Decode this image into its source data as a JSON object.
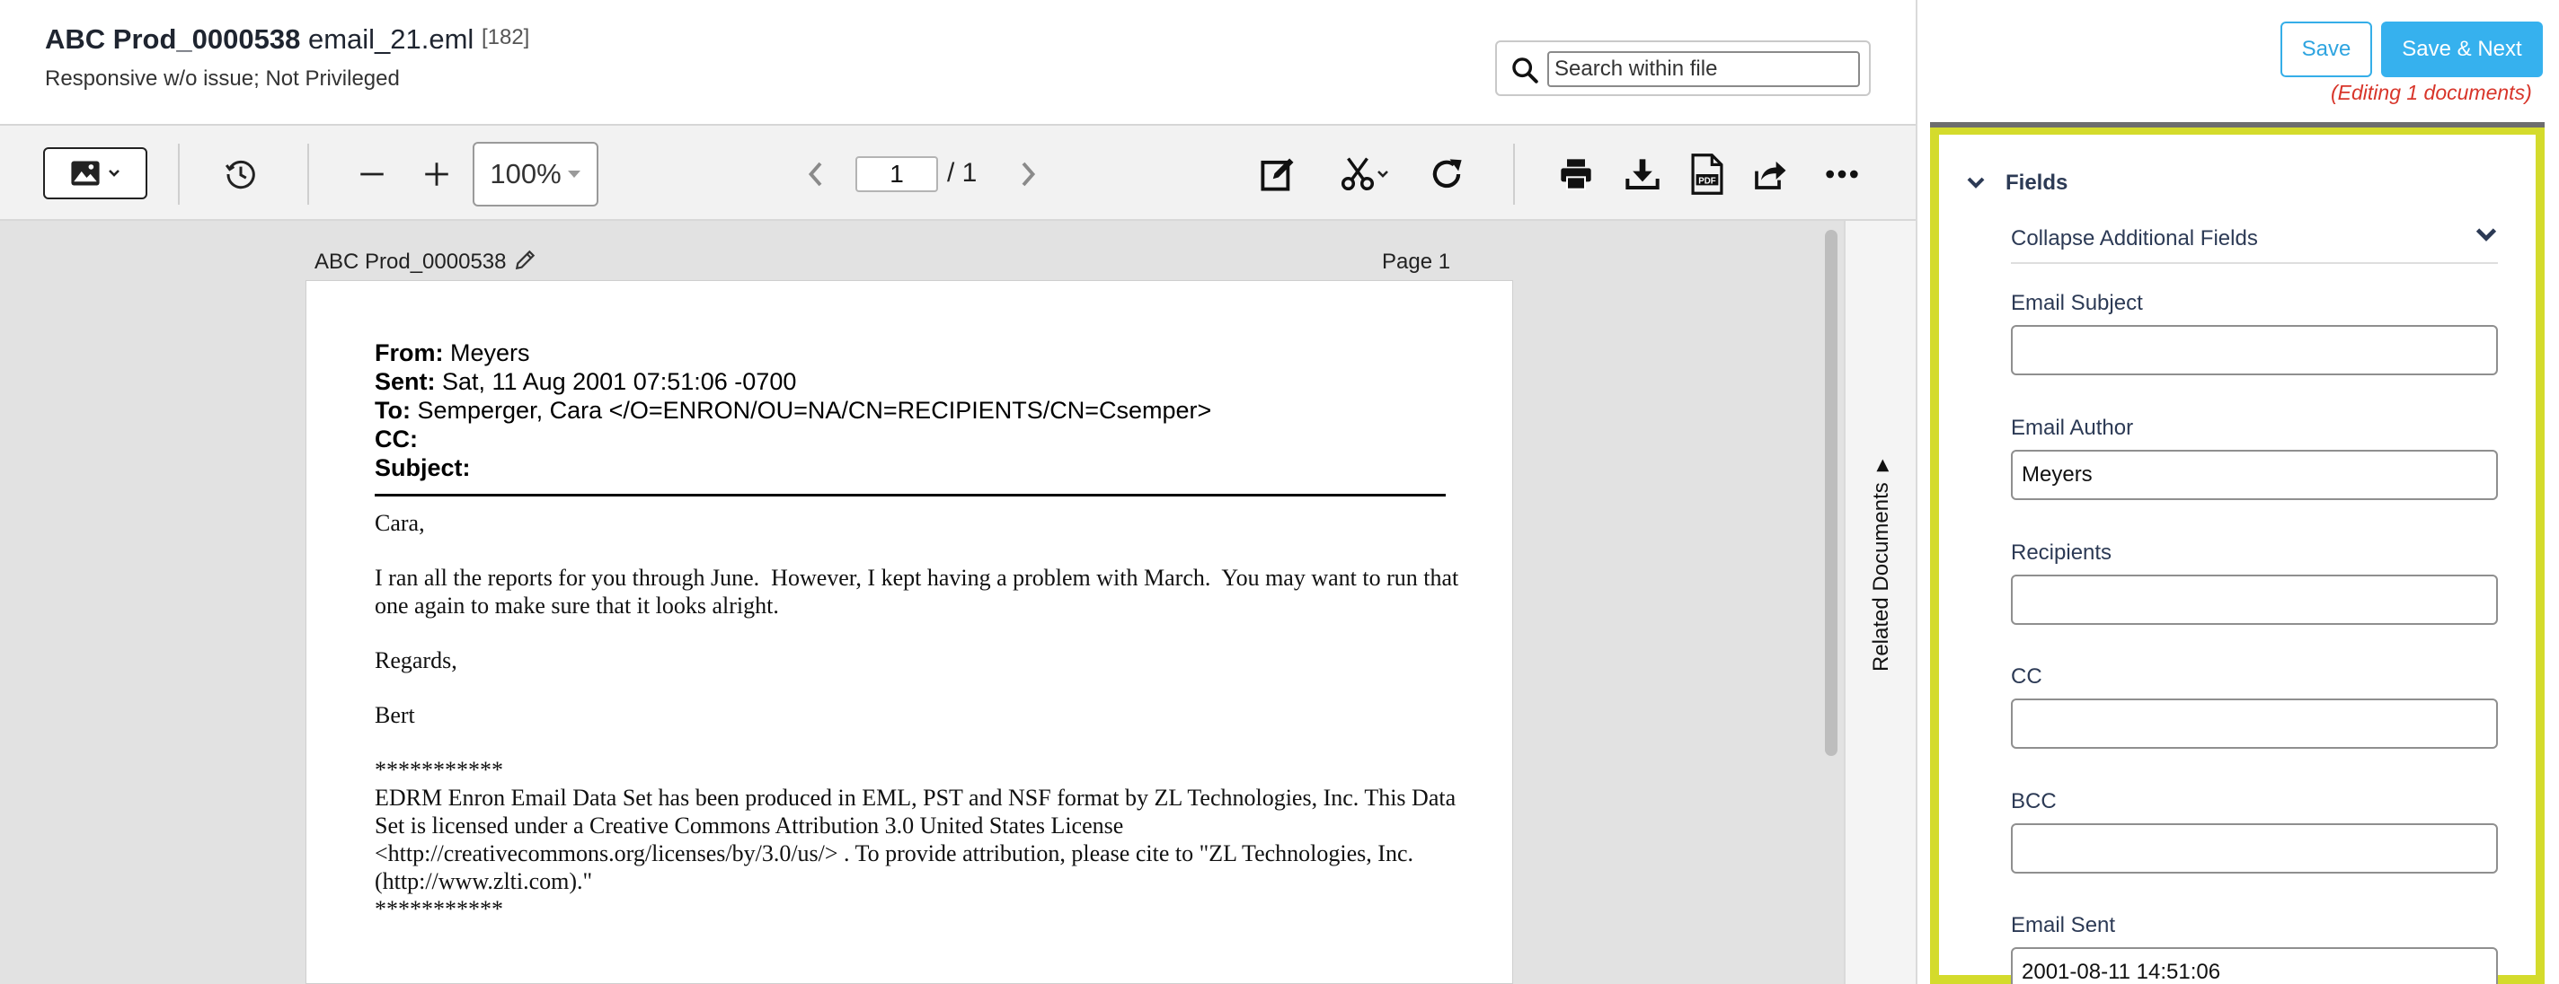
{
  "document": {
    "bates": "ABC Prod_0000538",
    "filename": "email_21.eml",
    "count": "[182]",
    "coding": "Responsive w/o issue; Not Privileged"
  },
  "search": {
    "placeholder": "Search within file"
  },
  "toolbar": {
    "zoom": "100%",
    "page_current": "1",
    "page_total": "/ 1",
    "icons": [
      "image-icon",
      "history-icon",
      "zoom-out-icon",
      "zoom-in-icon",
      "prev-page-icon",
      "next-page-icon",
      "annotate-icon",
      "redact-scissors-icon",
      "rotate-icon",
      "print-icon",
      "download-icon",
      "pdf-icon",
      "share-icon",
      "more-icon"
    ]
  },
  "viewer": {
    "page_label_left": "ABC Prod_0000538",
    "page_label_right": "Page 1",
    "related_documents": "Related Documents"
  },
  "email": {
    "from_label": "From:",
    "from": "Meyers",
    "sent_label": "Sent:",
    "sent": "Sat, 11 Aug 2001 07:51:06 -0700",
    "to_label": "To:",
    "to": "Semperger, Cara </O=ENRON/OU=NA/CN=RECIPIENTS/CN=Csemper>",
    "cc_label": "CC:",
    "subject_label": "Subject:",
    "body": {
      "greeting": "Cara,",
      "p1": "I ran all the reports for you through June.  However, I kept having a problem with March.  You may want to run that one again to make sure that it looks alright.",
      "regards": "Regards,",
      "signature": "Bert",
      "stars_top": "***********",
      "notice": "EDRM Enron Email Data Set has been produced in EML, PST and NSF format by ZL Technologies, Inc. This Data Set is licensed under a Creative Commons Attribution 3.0 United States License <http://creativecommons.org/licenses/by/3.0/us/> . To provide attribution, please cite to \"ZL Technologies, Inc. (http://www.zlti.com).\"",
      "stars_bottom": "***********"
    }
  },
  "actions": {
    "save": "Save",
    "save_next": "Save & Next",
    "editing_note": "(Editing 1 documents)"
  },
  "fields_panel": {
    "title": "Fields",
    "collapse_label": "Collapse Additional Fields",
    "accent_color": "#d4db2c",
    "fields": [
      {
        "label": "Email Subject",
        "value": ""
      },
      {
        "label": "Email Author",
        "value": "Meyers"
      },
      {
        "label": "Recipients",
        "value": ""
      },
      {
        "label": "CC",
        "value": ""
      },
      {
        "label": "BCC",
        "value": ""
      },
      {
        "label": "Email Sent",
        "value": "2001-08-11 14:51:06"
      }
    ]
  }
}
